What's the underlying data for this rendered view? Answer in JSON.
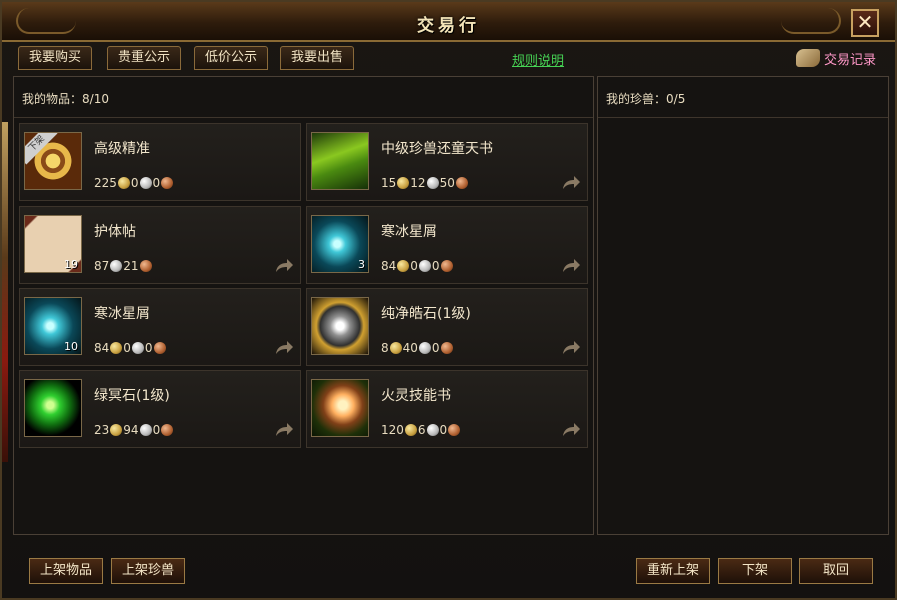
{
  "window": {
    "title": "交易行",
    "close_label": "✕"
  },
  "tabs": [
    {
      "label": "我要购买"
    },
    {
      "label": "贵重公示"
    },
    {
      "label": "低价公示"
    },
    {
      "label": "我要出售"
    }
  ],
  "rules_link": "规则说明",
  "history_label": "交易记录",
  "my_items": {
    "label": "我的物品：",
    "count": "8/10"
  },
  "my_pets": {
    "label": "我的珍兽：",
    "count": "0/5"
  },
  "items": [
    {
      "name": "高级精准",
      "gold": "225",
      "silver": "0",
      "copper": "0",
      "count": "",
      "badge": "下架",
      "icon": "compass-icon",
      "arrow": false
    },
    {
      "name": "中级珍兽还童天书",
      "gold": "15",
      "silver": "12",
      "copper": "50",
      "count": "",
      "badge": "",
      "icon": "scroll-book-icon",
      "arrow": true
    },
    {
      "name": "护体帖",
      "gold": "",
      "silver": "87",
      "copper": "21",
      "count": "19",
      "badge": "",
      "icon": "parchment-icon",
      "arrow": true
    },
    {
      "name": "寒冰星屑",
      "gold": "84",
      "silver": "0",
      "copper": "0",
      "count": "3",
      "badge": "",
      "icon": "ice-shard-icon",
      "arrow": true
    },
    {
      "name": "寒冰星屑",
      "gold": "84",
      "silver": "0",
      "copper": "0",
      "count": "10",
      "badge": "",
      "icon": "ice-shard-icon",
      "arrow": true
    },
    {
      "name": "纯净皓石(1级)",
      "gold": "8",
      "silver": "40",
      "copper": "0",
      "count": "",
      "badge": "",
      "icon": "diamond-icon",
      "arrow": true
    },
    {
      "name": "绿冥石(1级)",
      "gold": "23",
      "silver": "94",
      "copper": "0",
      "count": "",
      "badge": "",
      "icon": "green-gem-icon",
      "arrow": true
    },
    {
      "name": "火灵技能书",
      "gold": "120",
      "silver": "6",
      "copper": "0",
      "count": "",
      "badge": "",
      "icon": "fire-crystal-icon",
      "arrow": true
    }
  ],
  "buttons": {
    "list_item": "上架物品",
    "list_pet": "上架珍兽",
    "relist": "重新上架",
    "delist": "下架",
    "cancel": "取回"
  }
}
